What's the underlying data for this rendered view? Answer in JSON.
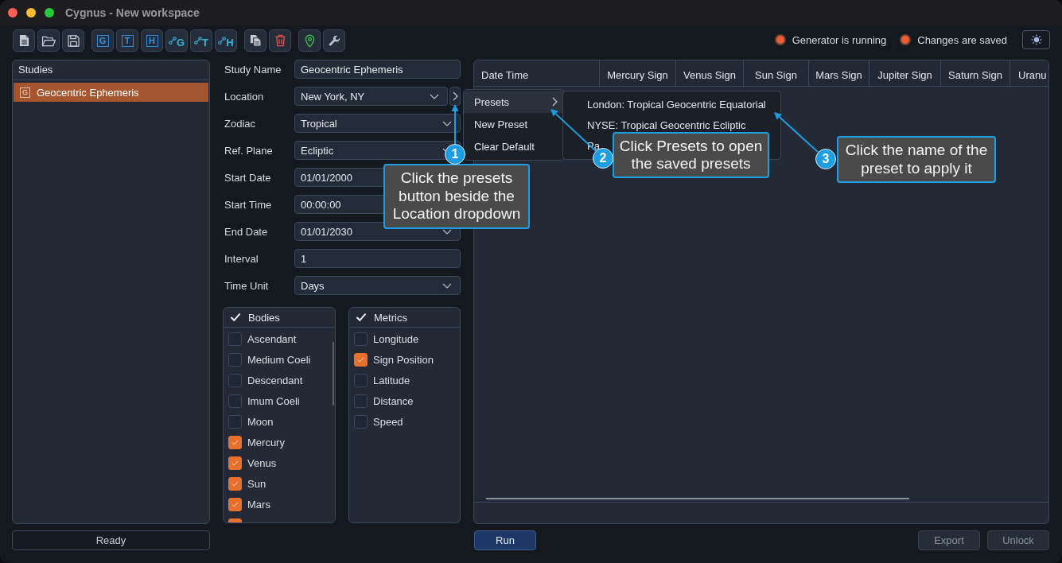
{
  "window": {
    "title": "Cygnus - New workspace"
  },
  "toolbar": {
    "groups": [
      [
        {
          "kind": "document"
        },
        {
          "kind": "folder"
        },
        {
          "kind": "save"
        }
      ],
      [
        {
          "kind": "letter",
          "label": "G"
        },
        {
          "kind": "letter",
          "label": "T"
        },
        {
          "kind": "letter",
          "label": "H"
        },
        {
          "kind": "link",
          "label": "G"
        },
        {
          "kind": "link",
          "label": "T"
        },
        {
          "kind": "link",
          "label": "H"
        }
      ],
      [
        {
          "kind": "copy"
        },
        {
          "kind": "trash"
        }
      ],
      [
        {
          "kind": "pin"
        },
        {
          "kind": "wrench"
        }
      ]
    ]
  },
  "status_indicators": [
    {
      "label": "Generator is running",
      "on": true
    },
    {
      "label": "Changes are saved",
      "on": true
    }
  ],
  "studies": {
    "title": "Studies",
    "items": [
      {
        "badge": "G",
        "label": "Geocentric Ephemeris",
        "selected": true
      }
    ]
  },
  "status_bar": {
    "text": "Ready"
  },
  "form": {
    "fields": [
      {
        "label": "Study Name",
        "kind": "text",
        "value": "Geocentric Ephemeris"
      },
      {
        "label": "Location",
        "kind": "dropdown-presets",
        "value": "New York, NY"
      },
      {
        "label": "Zodiac",
        "kind": "dropdown",
        "value": "Tropical"
      },
      {
        "label": "Ref. Plane",
        "kind": "dropdown",
        "value": "Ecliptic"
      },
      {
        "label": "Start Date",
        "kind": "text",
        "value": "01/01/2000"
      },
      {
        "label": "Start Time",
        "kind": "text",
        "value": "00:00:00"
      },
      {
        "label": "End Date",
        "kind": "dropdown",
        "value": "01/01/2030"
      },
      {
        "label": "Interval",
        "kind": "text",
        "value": "1"
      },
      {
        "label": "Time Unit",
        "kind": "dropdown",
        "value": "Days"
      }
    ]
  },
  "bodies": {
    "title": "Bodies",
    "items": [
      {
        "label": "Ascendant",
        "checked": false
      },
      {
        "label": "Medium Coeli",
        "checked": false
      },
      {
        "label": "Descendant",
        "checked": false
      },
      {
        "label": "Imum Coeli",
        "checked": false
      },
      {
        "label": "Moon",
        "checked": false
      },
      {
        "label": "Mercury",
        "checked": true
      },
      {
        "label": "Venus",
        "checked": true
      },
      {
        "label": "Sun",
        "checked": true
      },
      {
        "label": "Mars",
        "checked": true
      },
      {
        "checked": true
      }
    ]
  },
  "metrics": {
    "title": "Metrics",
    "items": [
      {
        "label": "Longitude",
        "checked": false
      },
      {
        "label": "Sign Position",
        "checked": true
      },
      {
        "label": "Latitude",
        "checked": false
      },
      {
        "label": "Distance",
        "checked": false
      },
      {
        "label": "Speed",
        "checked": false
      }
    ]
  },
  "table": {
    "columns": [
      "Date Time",
      "Mercury Sign",
      "Venus Sign",
      "Sun Sign",
      "Mars Sign",
      "Jupiter Sign",
      "Saturn Sign",
      "Uranu"
    ]
  },
  "buttons": [
    {
      "label": "Run",
      "kind": "primary",
      "disabled": false
    },
    {
      "label": "Export",
      "kind": "secondary",
      "disabled": true
    },
    {
      "label": "Unlock",
      "kind": "secondary",
      "disabled": true
    }
  ],
  "context_menu": {
    "items": [
      {
        "label": "Presets",
        "selected": true,
        "has_submenu": true
      },
      {
        "label": "New Preset",
        "selected": false,
        "has_submenu": false
      },
      {
        "label": "Clear Default",
        "selected": false,
        "has_submenu": false
      }
    ]
  },
  "submenu": {
    "items": [
      {
        "label": "London: Tropical Geocentric Equatorial"
      },
      {
        "label": "NYSE: Tropical Geocentric Ecliptic"
      },
      {
        "label": "Pa"
      }
    ]
  },
  "callouts": [
    {
      "number": "1",
      "text": "Click the presets button beside the Location dropdown"
    },
    {
      "number": "2",
      "text": "Click Presets to open the saved presets"
    },
    {
      "number": "3",
      "text": "Click the name of the preset to apply it"
    }
  ]
}
